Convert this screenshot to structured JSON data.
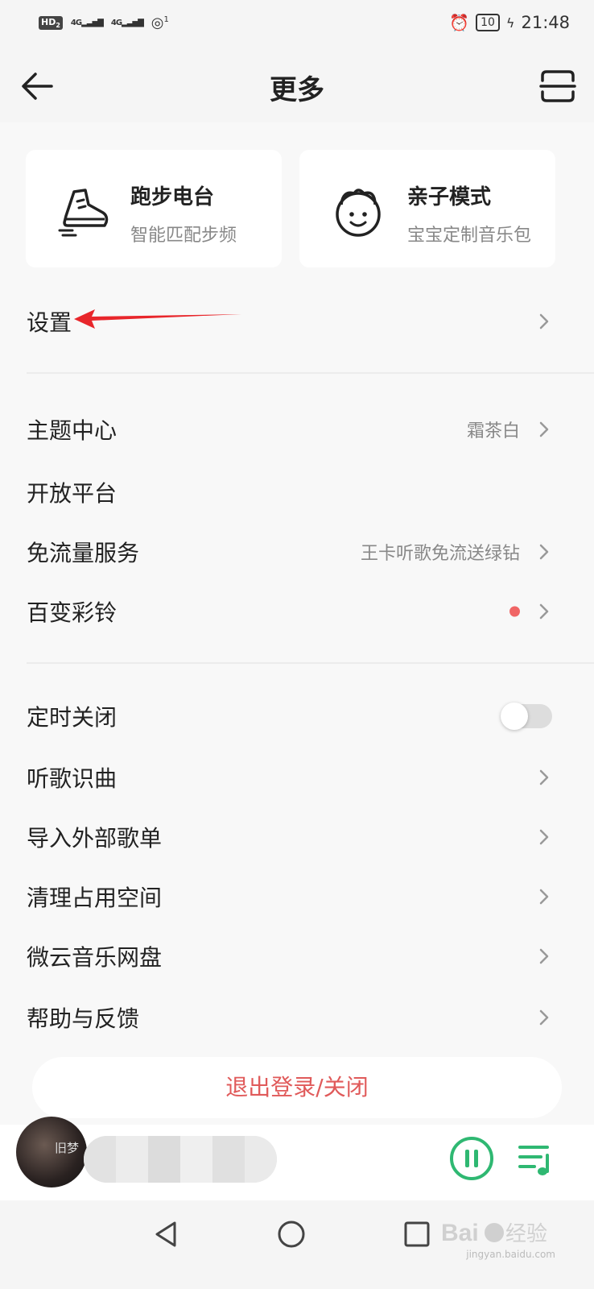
{
  "status_bar": {
    "hd_label": "HD",
    "hd_sub": "2",
    "sim1": "4G",
    "sim2": "4G",
    "hotspot_count": "1",
    "battery": "10",
    "time": "21:48"
  },
  "header": {
    "title": "更多"
  },
  "cards": [
    {
      "title": "跑步电台",
      "subtitle": "智能匹配步频",
      "icon": "running-shoe-icon"
    },
    {
      "title": "亲子模式",
      "subtitle": "宝宝定制音乐包",
      "icon": "baby-face-icon"
    }
  ],
  "settings": {
    "label": "设置"
  },
  "group1": [
    {
      "label": "主题中心",
      "value": "霜茶白"
    },
    {
      "label": "开放平台",
      "value": ""
    },
    {
      "label": "免流量服务",
      "value": "王卡听歌免流送绿钻"
    },
    {
      "label": "百变彩铃",
      "value": ""
    }
  ],
  "group2": [
    {
      "label": "定时关闭",
      "toggle": false
    },
    {
      "label": "听歌识曲"
    },
    {
      "label": "导入外部歌单"
    },
    {
      "label": "清理占用空间"
    },
    {
      "label": "微云音乐网盘"
    },
    {
      "label": "帮助与反馈"
    }
  ],
  "logout": {
    "label": "退出登录/关闭"
  },
  "player": {
    "album_text": "旧梦"
  },
  "colors": {
    "accent_green": "#2fb872",
    "logout_red": "#e05a5a",
    "annotation_red": "#e8262b",
    "dot_red": "#f06565"
  },
  "watermark": {
    "text": "jingyan.baidu.com"
  }
}
